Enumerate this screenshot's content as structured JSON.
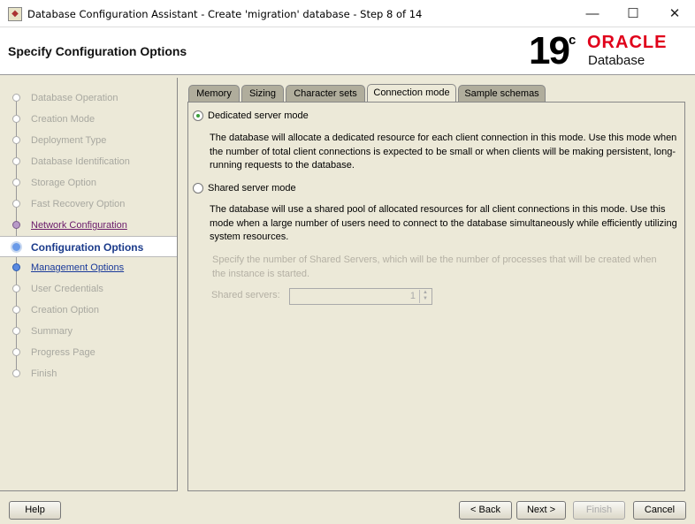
{
  "window": {
    "title": "Database Configuration Assistant - Create 'migration' database - Step 8 of 14",
    "minimize": "—",
    "maximize": "☐",
    "close": "✕"
  },
  "header": {
    "page_title": "Specify Configuration Options",
    "logo_version": "19",
    "logo_c": "c",
    "logo_brand": "ORACLE",
    "logo_product": "Database"
  },
  "steps": [
    {
      "label": "Database Operation",
      "state": "done"
    },
    {
      "label": "Creation Mode",
      "state": "done"
    },
    {
      "label": "Deployment Type",
      "state": "done"
    },
    {
      "label": "Database Identification",
      "state": "done"
    },
    {
      "label": "Storage Option",
      "state": "done"
    },
    {
      "label": "Fast Recovery Option",
      "state": "done"
    },
    {
      "label": "Network Configuration",
      "state": "visited"
    },
    {
      "label": "Configuration Options",
      "state": "active"
    },
    {
      "label": "Management Options",
      "state": "next"
    },
    {
      "label": "User Credentials",
      "state": "pending"
    },
    {
      "label": "Creation Option",
      "state": "pending"
    },
    {
      "label": "Summary",
      "state": "pending"
    },
    {
      "label": "Progress Page",
      "state": "pending"
    },
    {
      "label": "Finish",
      "state": "pending"
    }
  ],
  "tabs": [
    "Memory",
    "Sizing",
    "Character sets",
    "Connection mode",
    "Sample schemas"
  ],
  "content": {
    "dedicated_label": "Dedicated server mode",
    "dedicated_desc": "The database will allocate a dedicated resource for each client connection in this mode. Use this mode when the number of total client connections is expected to be small or when clients will be making persistent, long-running requests to the database.",
    "shared_label": "Shared server mode",
    "shared_desc": "The database will use a shared pool of allocated resources for all client connections in this mode.  Use this mode when a large number of users need to connect to the database simultaneously while efficiently utilizing system resources.",
    "shared_hint": "Specify the number of Shared Servers, which will be the number of processes that will be created when the instance is started.",
    "shared_servers_label": "Shared servers:",
    "shared_servers_value": "1"
  },
  "buttons": {
    "help": "Help",
    "back": "< Back",
    "next": "Next >",
    "finish": "Finish",
    "cancel": "Cancel"
  }
}
